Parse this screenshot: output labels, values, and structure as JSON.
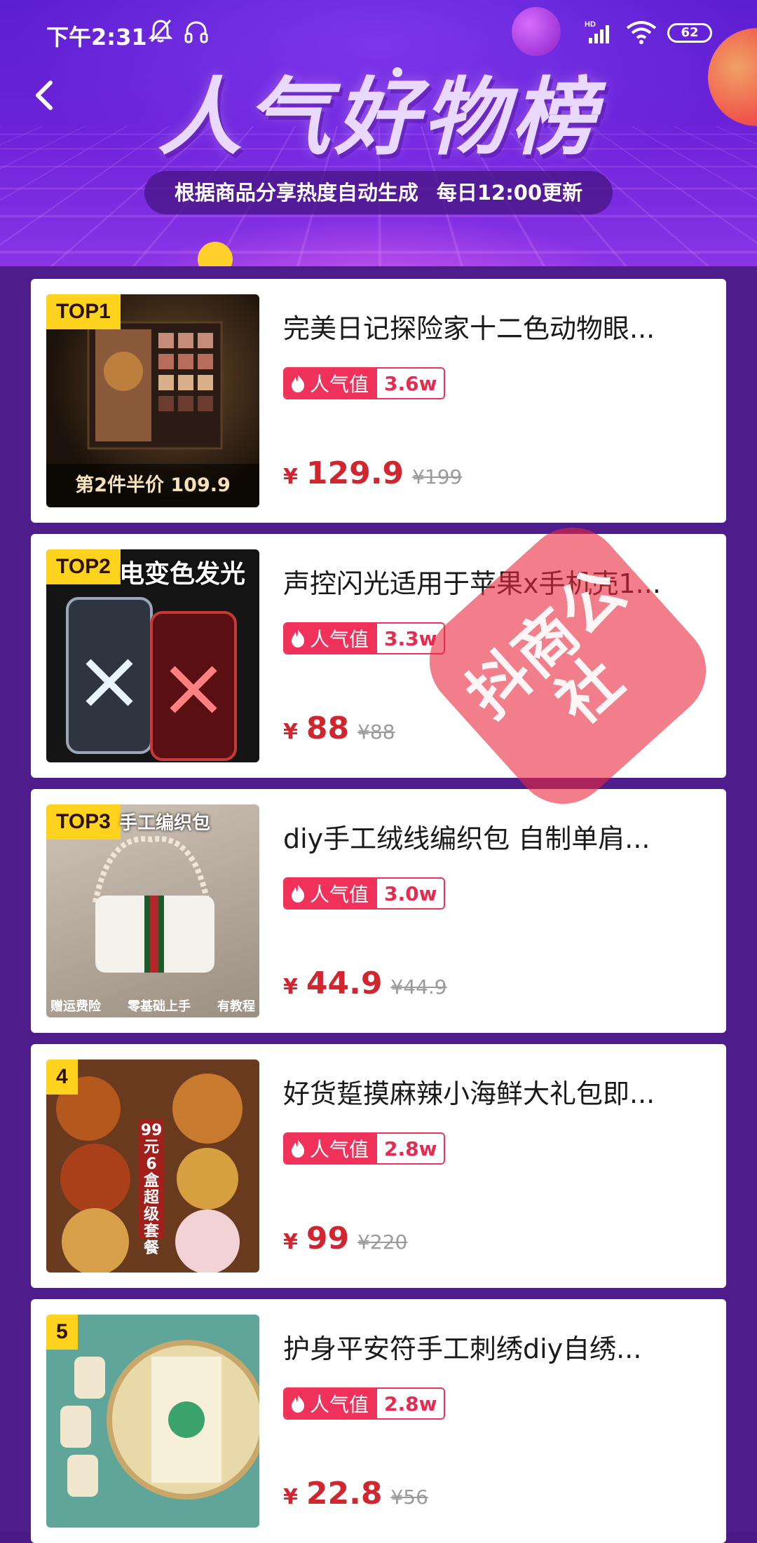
{
  "status_bar": {
    "time": "下午2:31",
    "battery": "62",
    "network_label": "HD"
  },
  "header": {
    "title": "人气好物榜",
    "subtitle_left": "根据商品分享热度自动生成",
    "subtitle_right": "每日12:00更新"
  },
  "colors": {
    "accent_red": "#d1262f",
    "popularity_pink": "#f0325a",
    "badge_yellow": "#ffd21e",
    "page_purple": "#4f1c8c"
  },
  "watermark": {
    "text": "抖商公社"
  },
  "products": [
    {
      "rank": "TOP1",
      "title": "完美日记探险家十二色动物眼...",
      "popularity_label": "人气值",
      "popularity_value": "3.6w",
      "currency": "¥",
      "price": "129.9",
      "original_price": "¥199",
      "thumb_caption": "第2件半价  109.9"
    },
    {
      "rank": "TOP2",
      "title": "声控闪光适用于苹果x手机壳1...",
      "popularity_label": "人气值",
      "popularity_value": "3.3w",
      "currency": "¥",
      "price": "88",
      "original_price": "¥88",
      "thumb_top_text": "电变色发光"
    },
    {
      "rank": "TOP3",
      "title": "diy手工绒线编织包 自制单肩...",
      "popularity_label": "人气值",
      "popularity_value": "3.0w",
      "currency": "¥",
      "price": "44.9",
      "original_price": "¥44.9",
      "thumb_top_text": "手工编织包",
      "thumb_bottom": [
        "赠运费险",
        "零基础上手",
        "有教程"
      ]
    },
    {
      "rank": "4",
      "title": "好货踅摸麻辣小海鲜大礼包即...",
      "popularity_label": "人气值",
      "popularity_value": "2.8w",
      "currency": "¥",
      "price": "99",
      "original_price": "¥220",
      "thumb_vertical": "99元6盒超级套餐"
    },
    {
      "rank": "5",
      "title": "护身平安符手工刺绣diy自绣...",
      "popularity_label": "人气值",
      "popularity_value": "2.8w",
      "currency": "¥",
      "price": "22.8",
      "original_price": "¥56"
    }
  ]
}
